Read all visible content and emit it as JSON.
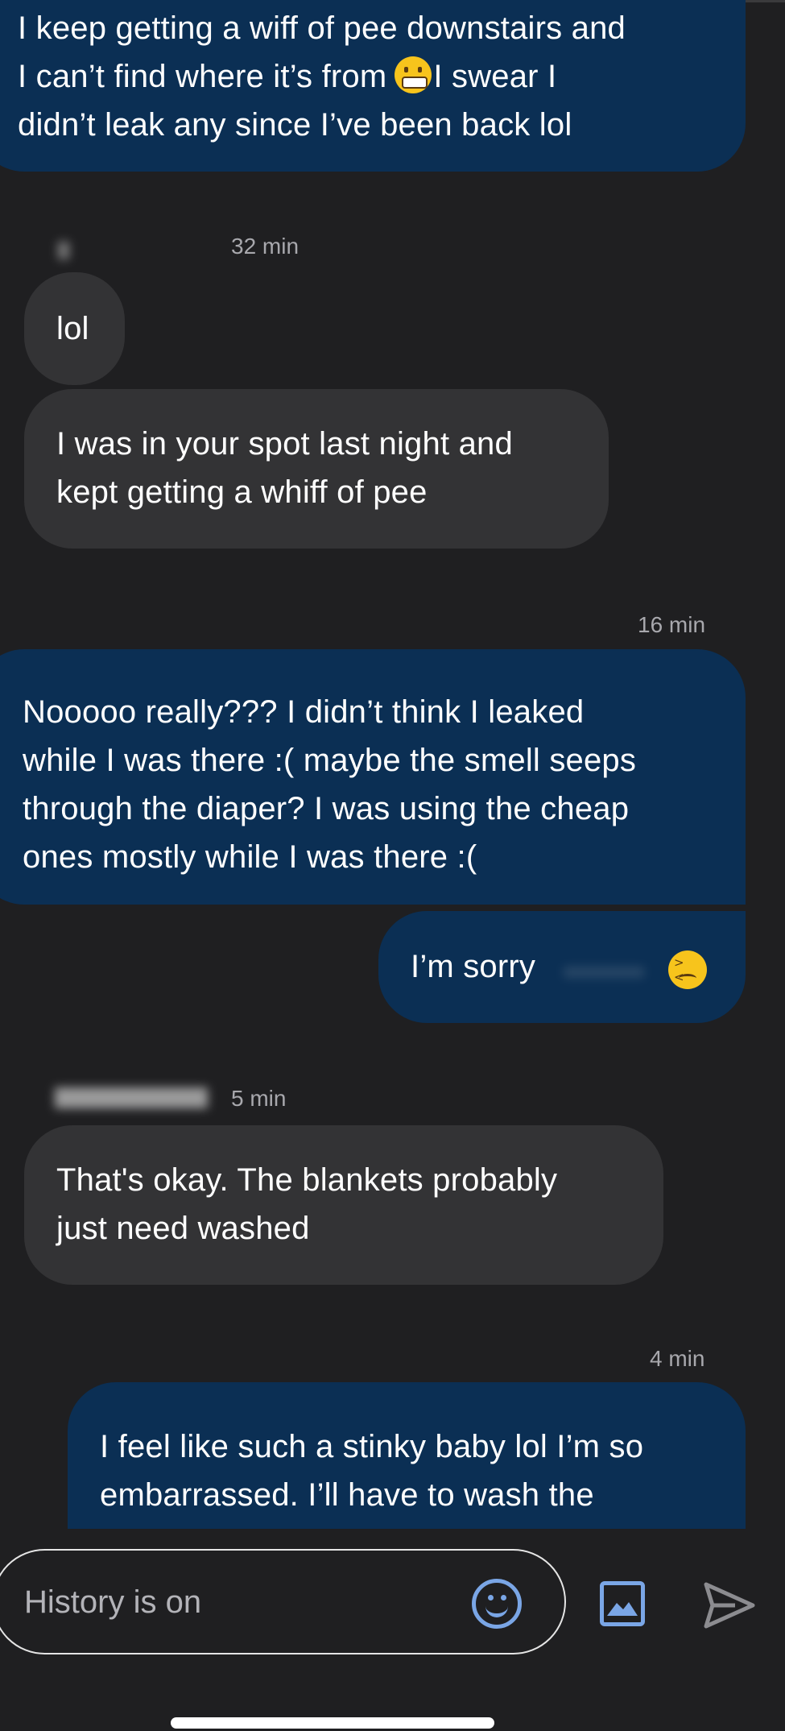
{
  "messages": [
    {
      "id": "m1",
      "direction": "outgoing",
      "text": "I keep getting a wiff of pee downstairs and\nI can’t find where it’s from",
      "text_after_emoji": "I swear I\ndidn’t leak any since I’ve been back lol",
      "emoji": "grimacing-face"
    },
    {
      "id": "m2",
      "direction": "incoming",
      "text": "lol"
    },
    {
      "id": "m3",
      "direction": "incoming",
      "text": "I was in your spot last night and\nkept getting a whiff of pee"
    },
    {
      "id": "m4",
      "direction": "outgoing",
      "text": "Nooooo really??? I didn’t think I leaked\nwhile I was there :( maybe the smell seeps\nthrough the diaper? I was using the cheap\nones mostly while I was there :("
    },
    {
      "id": "m5",
      "direction": "outgoing",
      "text": "I’m sorry",
      "emoji": "confounded-face"
    },
    {
      "id": "m6",
      "direction": "incoming",
      "text": "That's okay. The blankets probably\njust need washed"
    },
    {
      "id": "m7",
      "direction": "outgoing",
      "text": "I feel like such a stinky baby lol I’m so\nembarrassed. I’ll have to wash the"
    }
  ],
  "timestamps": {
    "t1": "32 min",
    "t2": "16 min",
    "t3": "5 min",
    "t4": "4 min"
  },
  "composer": {
    "placeholder": "History is on",
    "emoji_icon": "smiley-icon",
    "image_icon": "image-icon",
    "send_icon": "send-icon"
  },
  "colors": {
    "background": "#1f1f21",
    "outgoing_bubble": "#0b2f54",
    "incoming_bubble": "#333335",
    "accent": "#7aa6e6"
  }
}
